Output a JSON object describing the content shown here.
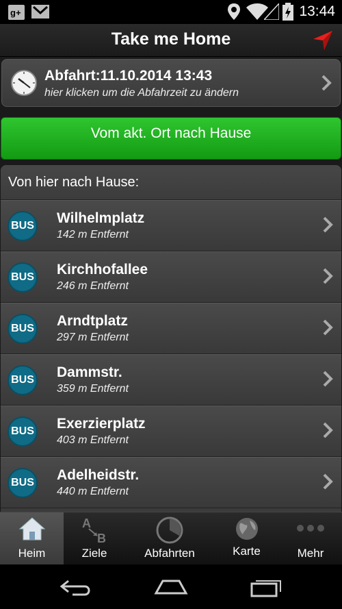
{
  "status_bar": {
    "time": "13:44",
    "icons": [
      "google-plus-icon",
      "gmail-icon",
      "location-icon",
      "wifi-icon",
      "signal-icon",
      "battery-charging-icon"
    ]
  },
  "header": {
    "title": "Take me Home",
    "nav_icon": "navigation-arrow-icon",
    "accent": "#e8201c"
  },
  "departure": {
    "title": "Abfahrt:11.10.2014 13:43",
    "subtitle": "hier klicken um die Abfahrzeit zu ändern",
    "icon": "clock-icon"
  },
  "home_button": {
    "label": "Vom akt. Ort nach Hause",
    "color": "#22b322"
  },
  "list": {
    "header": "Von hier nach Hause:",
    "badge_label": "BUS",
    "badge_color": "#0f6b86",
    "stops": [
      {
        "name": "Wilhelmplatz",
        "distance": "142 m Entfernt"
      },
      {
        "name": "Kirchhofallee",
        "distance": "246 m Entfernt"
      },
      {
        "name": "Arndtplatz",
        "distance": "297 m Entfernt"
      },
      {
        "name": "Dammstr.",
        "distance": "359 m Entfernt"
      },
      {
        "name": "Exerzierplatz",
        "distance": "403 m Entfernt"
      },
      {
        "name": "Adelheidstr.",
        "distance": "440 m Entfernt"
      }
    ]
  },
  "tabs": [
    {
      "label": "Heim",
      "icon": "home-icon",
      "active": true
    },
    {
      "label": "Ziele",
      "icon": "a-to-b-icon",
      "active": false
    },
    {
      "label": "Abfahrten",
      "icon": "pie-clock-icon",
      "active": false
    },
    {
      "label": "Karte",
      "icon": "globe-icon",
      "active": false
    },
    {
      "label": "Mehr",
      "icon": "more-dots-icon",
      "active": false
    }
  ],
  "system_nav": [
    "back-icon",
    "home-nav-icon",
    "recents-icon"
  ]
}
